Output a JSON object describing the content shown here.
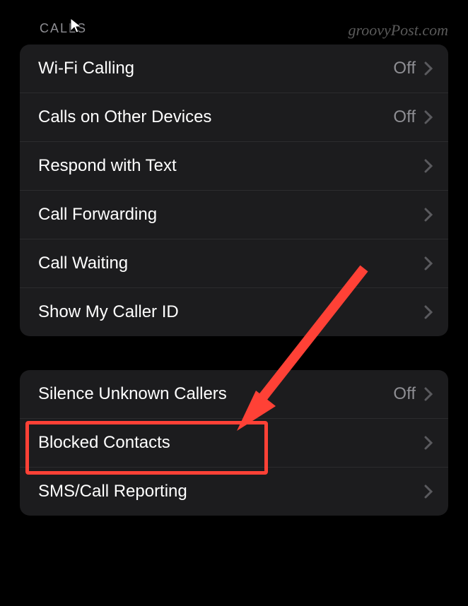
{
  "watermark": "groovyPost.com",
  "section_header": "CALLS",
  "groups": [
    {
      "rows": [
        {
          "label": "Wi-Fi Calling",
          "value": "Off"
        },
        {
          "label": "Calls on Other Devices",
          "value": "Off"
        },
        {
          "label": "Respond with Text",
          "value": ""
        },
        {
          "label": "Call Forwarding",
          "value": ""
        },
        {
          "label": "Call Waiting",
          "value": ""
        },
        {
          "label": "Show My Caller ID",
          "value": ""
        }
      ]
    },
    {
      "rows": [
        {
          "label": "Silence Unknown Callers",
          "value": "Off"
        },
        {
          "label": "Blocked Contacts",
          "value": ""
        },
        {
          "label": "SMS/Call Reporting",
          "value": ""
        }
      ]
    }
  ],
  "annotation": {
    "highlight_color": "#ff4136",
    "arrow_color": "#ff4136"
  }
}
